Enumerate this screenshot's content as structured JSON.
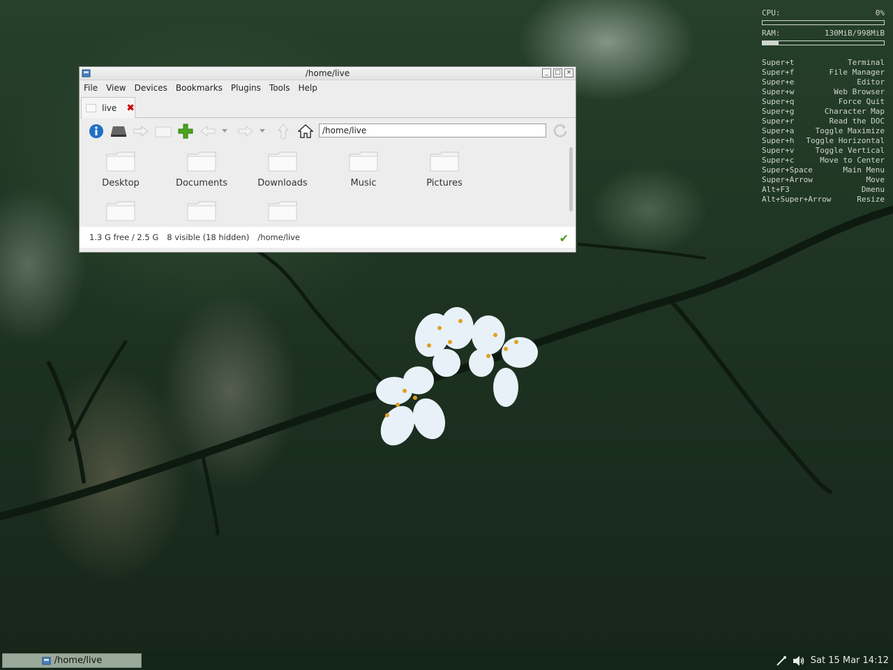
{
  "conky": {
    "cpu_label": "CPU:",
    "cpu_value": "0%",
    "cpu_fraction": 0.0,
    "ram_label": "RAM:",
    "ram_value": "130MiB/998MiB",
    "ram_fraction": 0.13,
    "shortcuts": [
      {
        "key": "Super+t",
        "action": "Terminal"
      },
      {
        "key": "Super+f",
        "action": "File Manager"
      },
      {
        "key": "Super+e",
        "action": "Editor"
      },
      {
        "key": "Super+w",
        "action": "Web Browser"
      },
      {
        "key": "Super+q",
        "action": "Force Quit"
      },
      {
        "key": "Super+g",
        "action": "Character Map"
      },
      {
        "key": "Super+r",
        "action": "Read the DOC"
      },
      {
        "key": "Super+a",
        "action": "Toggle Maximize"
      },
      {
        "key": "Super+h",
        "action": "Toggle Horizontal"
      },
      {
        "key": "Super+v",
        "action": "Toggle Vertical"
      },
      {
        "key": "Super+c",
        "action": "Move to Center"
      },
      {
        "key": "Super+Space",
        "action": "Main Menu"
      },
      {
        "key": "Super+Arrow",
        "action": "Move"
      },
      {
        "key": "Alt+F3",
        "action": "Dmenu"
      },
      {
        "key": "Alt+Super+Arrow",
        "action": "Resize"
      }
    ]
  },
  "window": {
    "title": "/home/live",
    "menu": [
      "File",
      "View",
      "Devices",
      "Bookmarks",
      "Plugins",
      "Tools",
      "Help"
    ],
    "tab_label": "live",
    "path_value": "/home/live",
    "folders": [
      "Desktop",
      "Documents",
      "Downloads",
      "Music",
      "Pictures",
      "",
      "",
      ""
    ],
    "status": {
      "free": "1.3 G free / 2.5 G",
      "visible": "8 visible (18 hidden)",
      "path": "/home/live"
    }
  },
  "taskbar": {
    "task_label": "/home/live",
    "clock": "Sat 15 Mar 14:12"
  }
}
